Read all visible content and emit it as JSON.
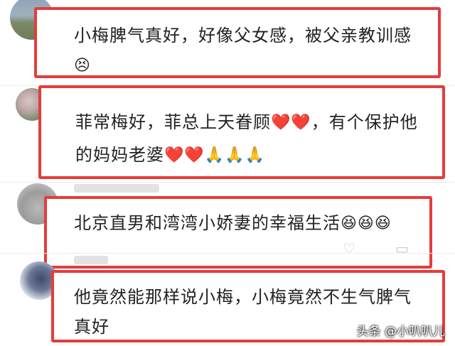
{
  "comments": [
    {
      "text": "小梅脾气真好，好像父女感，被父亲教训感",
      "emoji": [
        "😣"
      ]
    },
    {
      "line1_text": "菲常梅好，菲总上天眷顾",
      "line1_emoji": "❤️❤️",
      "line1_tail": "，有个保护他",
      "line2_text": "的妈妈老婆",
      "line2_emoji": "❤️❤️🙏🙏🙏"
    },
    {
      "text": "北京直男和湾湾小娇妻的幸福生活",
      "emoji": "😆😆😆"
    },
    {
      "line1": "他竟然能那样说小梅，小梅竟然不生气脾气",
      "line2": "真好"
    }
  ],
  "watermark": "头条 @小叭叭儿",
  "colors": {
    "highlight_border": "#e63b3b",
    "text": "#222222"
  },
  "icons": [
    "like-icon",
    "comment-icon"
  ]
}
